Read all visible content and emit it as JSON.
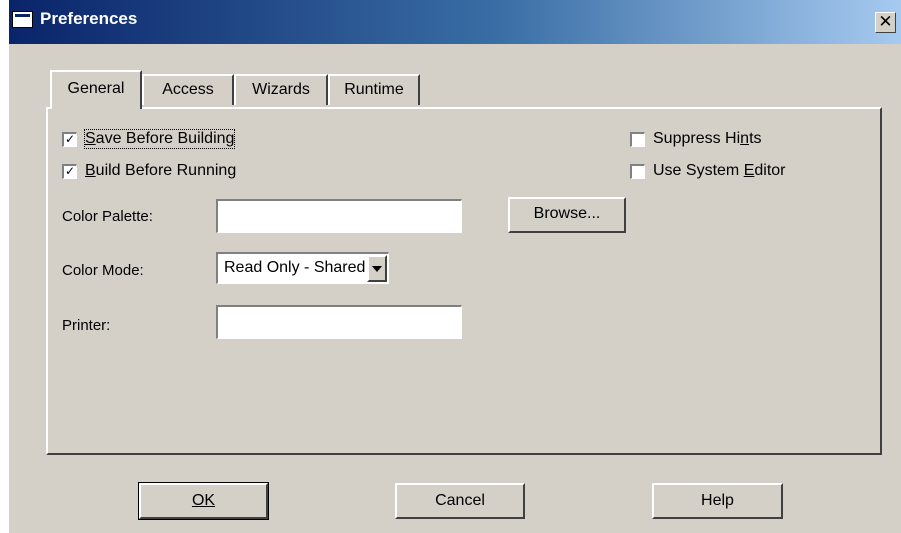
{
  "window": {
    "title": "Preferences",
    "close_glyph": "✕"
  },
  "tabs": [
    {
      "label": "General",
      "active": true
    },
    {
      "label": "Access",
      "active": false
    },
    {
      "label": "Wizards",
      "active": false
    },
    {
      "label": "Runtime",
      "active": false
    }
  ],
  "general": {
    "save_before_building": {
      "label": "Save Before Building",
      "mnemonic": "S",
      "checked": true
    },
    "build_before_running": {
      "label": "Build Before Running",
      "mnemonic": "B",
      "checked": true
    },
    "suppress_hints": {
      "label": "Suppress Hints",
      "mnemonic": "n",
      "checked": false
    },
    "use_system_editor": {
      "label": "Use System Editor",
      "mnemonic": "E",
      "checked": false
    },
    "color_palette": {
      "label": "Color Palette:",
      "value": ""
    },
    "browse_button": "Browse...",
    "color_mode": {
      "label": "Color Mode:",
      "value": "Read Only - Shared"
    },
    "printer": {
      "label": "Printer:",
      "value": ""
    }
  },
  "buttons": {
    "ok": "OK",
    "cancel": "Cancel",
    "help": "Help"
  },
  "colors": {
    "titlebar_start": "#0a246a",
    "titlebar_end": "#a6caf0",
    "face": "#d4d0c8"
  },
  "icons": {
    "window_icon": "window-icon",
    "close_icon": "close-icon",
    "checkmark_icon": "checkmark-icon",
    "dropdown_arrow_icon": "dropdown-arrow-icon"
  }
}
